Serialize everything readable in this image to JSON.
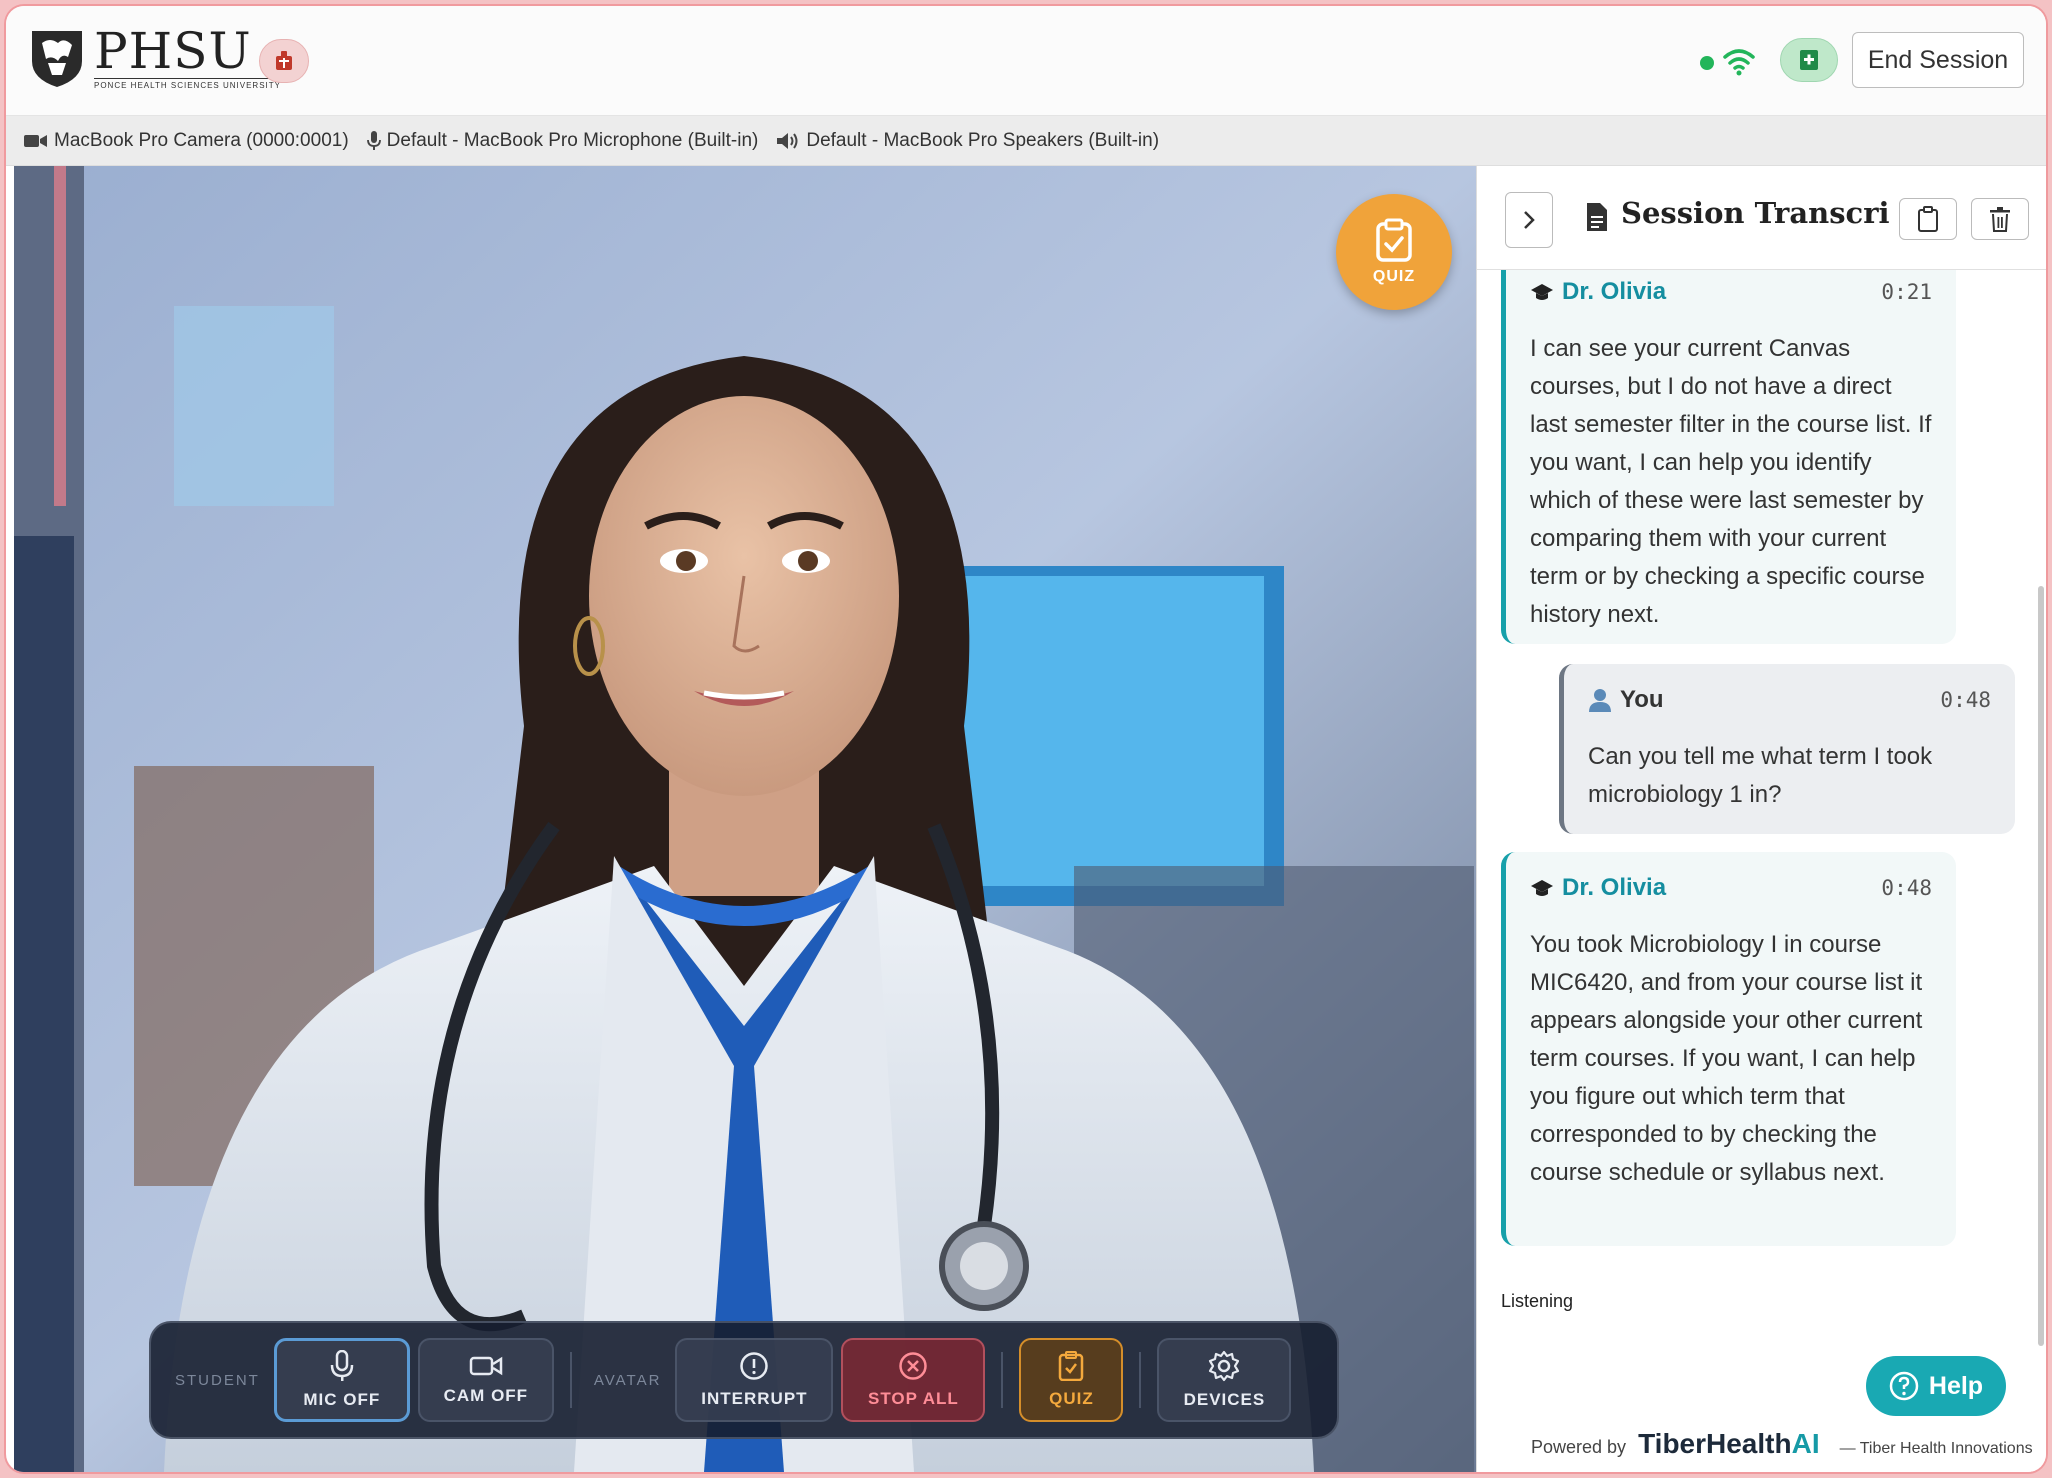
{
  "header": {
    "logo_title": "PHSU",
    "logo_subtitle": "PONCE HEALTH SCIENCES UNIVERSITY",
    "end_session_label": "End Session"
  },
  "devices": {
    "camera": "MacBook Pro Camera (0000:0001)",
    "microphone": "Default - MacBook Pro Microphone (Built-in)",
    "speakers": "Default - MacBook Pro Speakers (Built-in)"
  },
  "video": {
    "quiz_fab_label": "QUIZ"
  },
  "controls": {
    "student_label": "STUDENT",
    "mic_label": "MIC OFF",
    "cam_label": "CAM OFF",
    "avatar_label": "AVATAR",
    "interrupt_label": "INTERRUPT",
    "stop_all_label": "STOP ALL",
    "quiz_label": "QUIZ",
    "devices_label": "DEVICES"
  },
  "transcript": {
    "title": "Session Transcript",
    "messages": [
      {
        "speaker": "Dr. Olivia",
        "time": "0:21",
        "text": "I can see your current Canvas courses, but I do not have a direct last semester filter in the course list. If you want, I can help you identify which of these were last semester by comparing them with your current term or by checking a specific course history next."
      },
      {
        "speaker": "You",
        "time": "0:48",
        "text": "Can you tell me what term I took microbiology 1 in?"
      },
      {
        "speaker": "Dr. Olivia",
        "time": "0:48",
        "text": "You took Microbiology I in course MIC6420, and from your course list it appears alongside your other current term courses. If you want, I can help you figure out which term that corresponded to by checking the course schedule or syllabus next."
      }
    ],
    "status": "Listening"
  },
  "footer": {
    "help_label": "Help",
    "powered_by": "Powered by",
    "brand_main": "TiberHealth",
    "brand_accent": "AI",
    "company": "— Tiber Health Innovations"
  },
  "colors": {
    "accent_teal": "#17a0aa",
    "quiz_orange": "#f0a33a",
    "stop_red": "#b2505d",
    "status_green": "#22b55a"
  },
  "icons": [
    "shield-logo-icon",
    "alert-icon",
    "wifi-icon",
    "medical-plus-icon",
    "camera-icon",
    "microphone-icon",
    "speaker-icon",
    "clipboard-check-icon",
    "mic-icon",
    "video-camera-icon",
    "exclamation-circle-icon",
    "x-circle-icon",
    "gear-icon",
    "chevron-right-icon",
    "document-icon",
    "clipboard-icon",
    "trash-icon",
    "graduation-cap-icon",
    "user-icon",
    "question-circle-icon"
  ]
}
